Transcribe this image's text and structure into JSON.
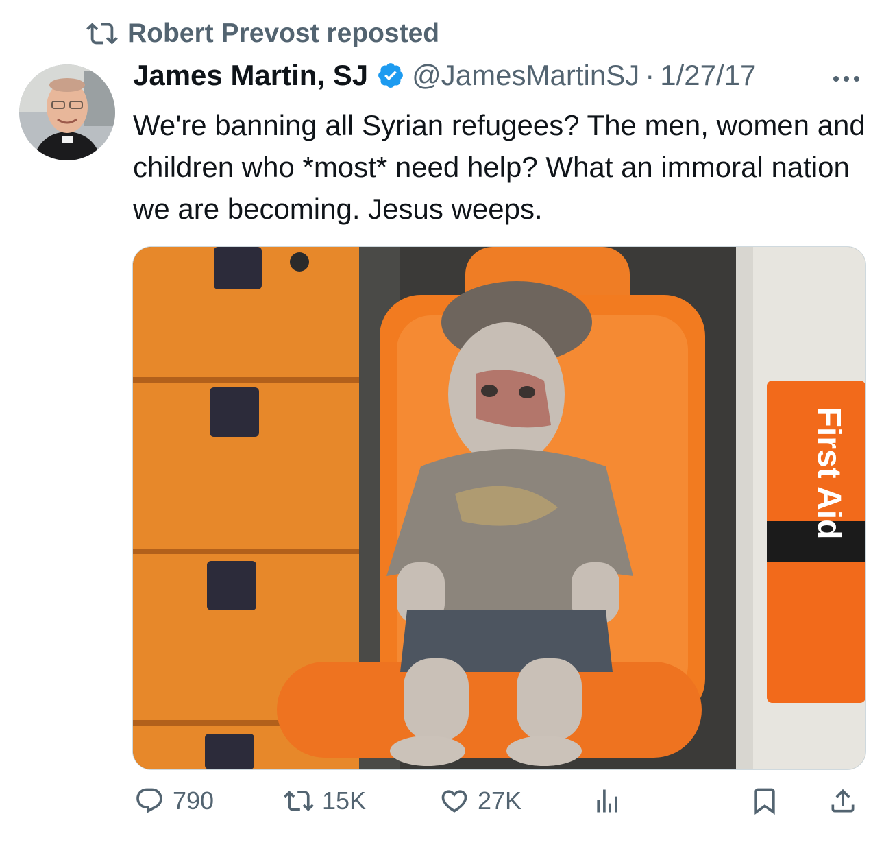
{
  "repost": {
    "label": "Robert Prevost reposted",
    "icon": "repost-icon"
  },
  "tweet": {
    "author_name": "James Martin, SJ",
    "verified_icon": "verified-badge-icon",
    "verified_color": "#1d9bf0",
    "handle": "@JamesMartinSJ",
    "separator": "·",
    "date": "1/27/17",
    "text": "We're banning all Syrian refugees? The men, women and children who *most* need help? What an immoral nation we are becoming. Jesus weeps.",
    "media": {
      "icon": "photo-child-in-ambulance-seat",
      "visible_text": "First Aid"
    }
  },
  "actions": {
    "replies": "790",
    "reposts": "15K",
    "likes": "27K",
    "views_icon": "analytics-icon",
    "bookmark_icon": "bookmark-icon",
    "share_icon": "share-icon"
  },
  "colors": {
    "text": "#0f1419",
    "secondary": "#536471",
    "accent": "#1d9bf0"
  }
}
